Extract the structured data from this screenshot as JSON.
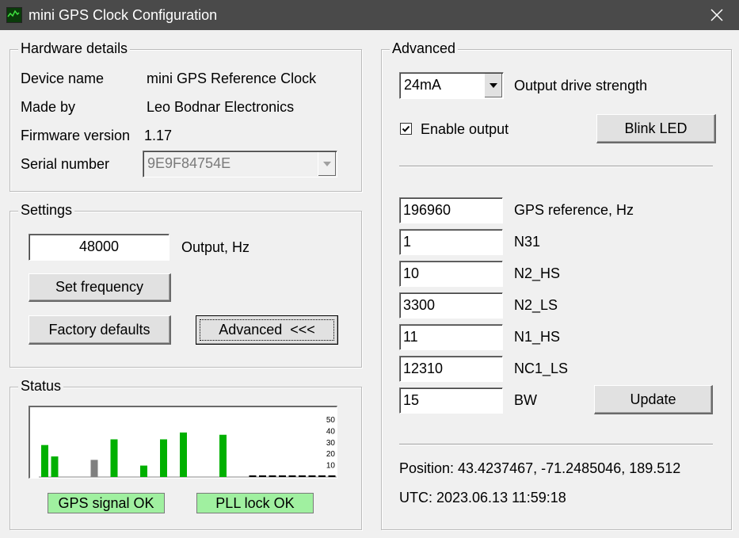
{
  "window": {
    "title": "mini GPS Clock Configuration"
  },
  "hardware": {
    "legend": "Hardware details",
    "device_name_label": "Device name",
    "device_name": "mini GPS Reference Clock",
    "made_by_label": "Made by",
    "made_by": "Leo Bodnar Electronics",
    "firmware_label": "Firmware version",
    "firmware": "1.17",
    "serial_label": "Serial number",
    "serial": "9E9F84754E"
  },
  "settings": {
    "legend": "Settings",
    "output_value": "48000",
    "output_label": "Output, Hz",
    "set_frequency": "Set frequency",
    "factory_defaults": "Factory defaults",
    "advanced": "Advanced  <<<"
  },
  "status": {
    "legend": "Status",
    "gps_signal": "GPS signal OK",
    "pll_lock": "PLL lock OK",
    "green_color": "#a0f0a0"
  },
  "chart_data": {
    "type": "bar",
    "ylim": [
      0,
      50
    ],
    "y_ticks": [
      "50",
      "40",
      "30",
      "20",
      "10"
    ],
    "values": [
      28,
      18,
      0,
      0,
      0,
      15,
      0,
      33,
      0,
      0,
      10,
      0,
      33,
      0,
      39,
      0,
      0,
      0,
      37,
      0,
      0,
      0,
      0,
      0,
      0,
      0,
      0,
      0,
      0,
      0
    ],
    "colors": [
      "#00b000",
      "#00b000",
      "",
      "",
      "",
      "#808080",
      "",
      "#00b000",
      "",
      "",
      "#00b000",
      "",
      "#00b000",
      "",
      "#00b000",
      "",
      "",
      "",
      "#00b000",
      "",
      "",
      "",
      "",
      "",
      "",
      "",
      "",
      "",
      "",
      ""
    ],
    "dark_baseline": [
      false,
      false,
      false,
      false,
      false,
      false,
      false,
      false,
      false,
      false,
      false,
      false,
      false,
      false,
      false,
      false,
      false,
      false,
      false,
      false,
      false,
      true,
      true,
      true,
      true,
      true,
      true,
      true,
      true,
      true
    ]
  },
  "advanced": {
    "legend": "Advanced",
    "drive_value": "24mA",
    "drive_label": "Output drive strength",
    "enable_output": "Enable output",
    "blink_led": "Blink LED",
    "update": "Update",
    "params": [
      {
        "value": "196960",
        "label": "GPS reference, Hz"
      },
      {
        "value": "1",
        "label": "N31"
      },
      {
        "value": "10",
        "label": "N2_HS"
      },
      {
        "value": "3300",
        "label": "N2_LS"
      },
      {
        "value": "11",
        "label": "N1_HS"
      },
      {
        "value": "12310",
        "label": "NC1_LS"
      },
      {
        "value": "15",
        "label": "BW"
      }
    ],
    "position": "Position: 43.4237467, -71.2485046, 189.512",
    "utc": "UTC: 2023.06.13 11:59:18"
  }
}
